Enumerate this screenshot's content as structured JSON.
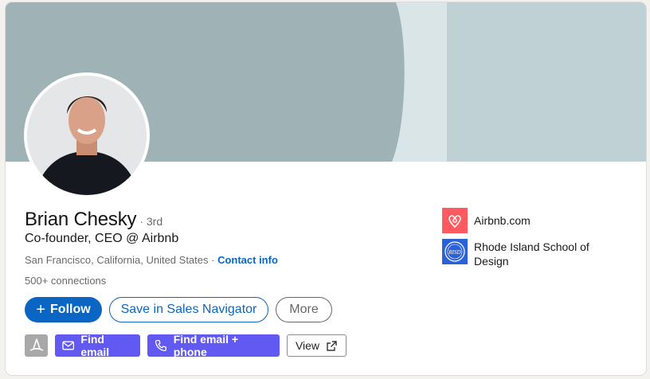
{
  "profile": {
    "name": "Brian Chesky",
    "degree": "· 3rd",
    "headline": "Co-founder, CEO @ Airbnb",
    "location": "San Francisco, California, United States",
    "separator": " · ",
    "contact_info": "Contact info",
    "connections": "500+ connections"
  },
  "actions": {
    "follow": "Follow",
    "follow_icon": "plus-icon",
    "sales_navigator": "Save in Sales Navigator",
    "more": "More"
  },
  "extension": {
    "hat_icon": "wizard-hat-icon",
    "find_email": "Find email",
    "find_email_phone": "Find email + phone",
    "view": "View",
    "accent_color": "#6159f2"
  },
  "sidebar": {
    "items": [
      {
        "label": "Airbnb.com",
        "icon": "airbnb-logo"
      },
      {
        "label": "Rhode Island School of Design",
        "icon": "risd-logo",
        "logo_text": "RISD"
      }
    ]
  },
  "colors": {
    "primary": "#0a66c2",
    "banner_dark": "#9fb2b6",
    "banner_light": "#dae5e7"
  }
}
